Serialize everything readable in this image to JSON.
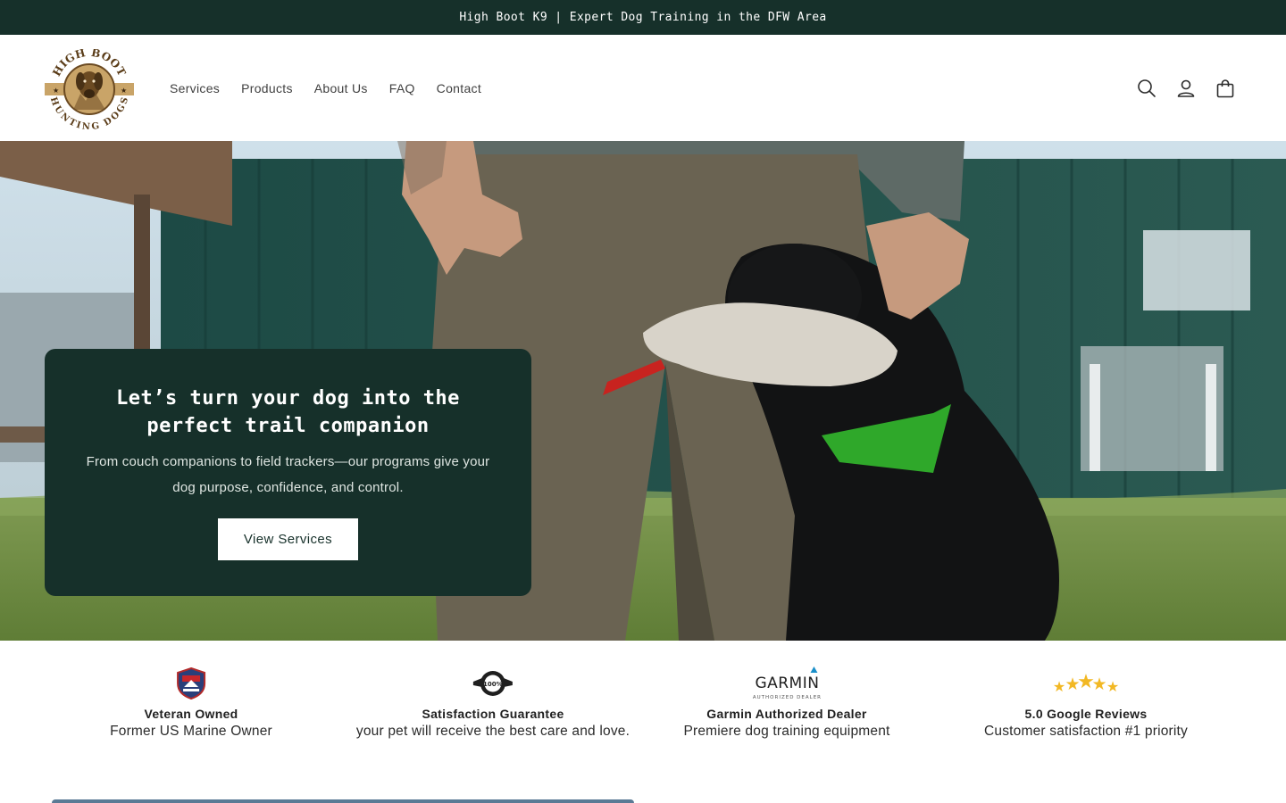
{
  "announcement": {
    "text": "High Boot K9 | Expert Dog Training in the DFW Area"
  },
  "logo": {
    "name": "High Boot Hunting Dogs logo",
    "text_top": "HIGH BOOT",
    "text_bottom": "HUNTING DOGS"
  },
  "nav": {
    "items": [
      {
        "label": "Services"
      },
      {
        "label": "Products"
      },
      {
        "label": "About Us"
      },
      {
        "label": "FAQ"
      },
      {
        "label": "Contact"
      }
    ]
  },
  "header_icons": [
    "search-icon",
    "account-icon",
    "cart-icon"
  ],
  "hero": {
    "title": "Let’s turn your dog into the perfect trail companion",
    "subtitle": "From couch companions to field trackers—our programs give your dog purpose, confidence, and control.",
    "button_label": "View Services"
  },
  "trust_badges": [
    {
      "icon": "veteran-shield-icon",
      "title": "Veteran Owned",
      "subtitle": "Former US Marine Owner"
    },
    {
      "icon": "guarantee-seal-icon",
      "badge_text": "100%",
      "title": "Satisfaction Guarantee",
      "subtitle": "your pet will receive the best care and love."
    },
    {
      "icon": "garmin-logo",
      "badge_text": "GARMIN",
      "badge_subtext": "AUTHORIZED DEALER",
      "title": "Garmin Authorized Dealer",
      "subtitle": "Premiere dog training equipment"
    },
    {
      "icon": "five-stars-icon",
      "title": "5.0 Google Reviews",
      "subtitle": "Customer satisfaction #1 priority"
    }
  ],
  "colors": {
    "brand_dark_green": "#16302a",
    "white": "#ffffff",
    "logo_brown": "#6b4a22",
    "logo_tan": "#c9a468",
    "star_gold": "#f2b824",
    "garmin_blue": "#1a8fc9"
  }
}
